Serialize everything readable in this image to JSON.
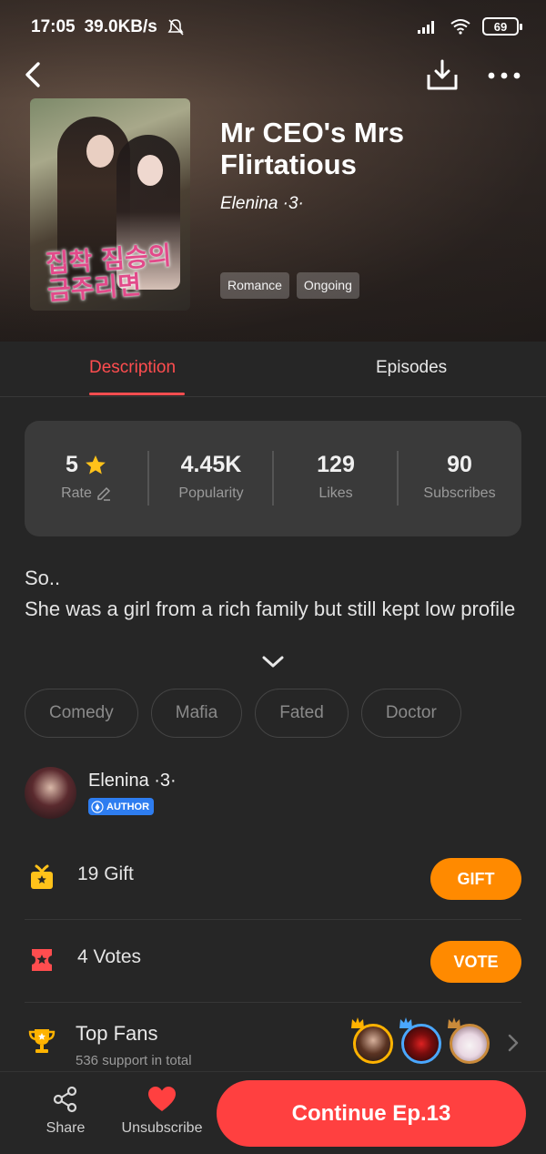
{
  "status_bar": {
    "time": "17:05",
    "speed": "39.0KB/s",
    "battery": "69"
  },
  "book": {
    "title": "Mr CEO's Mrs Flirtatious",
    "author": "Elenina ·3·",
    "tags": [
      "Romance",
      "Ongoing"
    ],
    "cover_text": "집착 짐승의 금주리면"
  },
  "tabs": {
    "description": "Description",
    "episodes": "Episodes",
    "active": "Description"
  },
  "stats": {
    "rate_value": "5",
    "rate_label": "Rate",
    "popularity_value": "4.45K",
    "popularity_label": "Popularity",
    "likes_value": "129",
    "likes_label": "Likes",
    "subscribes_value": "90",
    "subscribes_label": "Subscribes"
  },
  "description": {
    "line1": "So..",
    "line2": "She was a girl from a rich family but still kept low profile"
  },
  "keywords": [
    "Comedy",
    "Mafia",
    "Fated",
    "Doctor"
  ],
  "author_card": {
    "name": "Elenina ·3·",
    "badge": "AUTHOR"
  },
  "gift": {
    "text": "19 Gift",
    "button": "GIFT"
  },
  "vote": {
    "text": "4 Votes",
    "button": "VOTE"
  },
  "top_fans": {
    "title": "Top Fans",
    "subtitle": "536 support in total"
  },
  "bottom": {
    "share": "Share",
    "unsubscribe": "Unsubscribe",
    "continue": "Continue Ep.13"
  },
  "colors": {
    "accent_red": "#ff4d4f",
    "button_orange": "#ff8a00",
    "continue_red": "#ff4040",
    "background": "#262626",
    "card": "#3a3a3a",
    "author_badge": "#2e7df0",
    "star": "#ffc21a"
  }
}
